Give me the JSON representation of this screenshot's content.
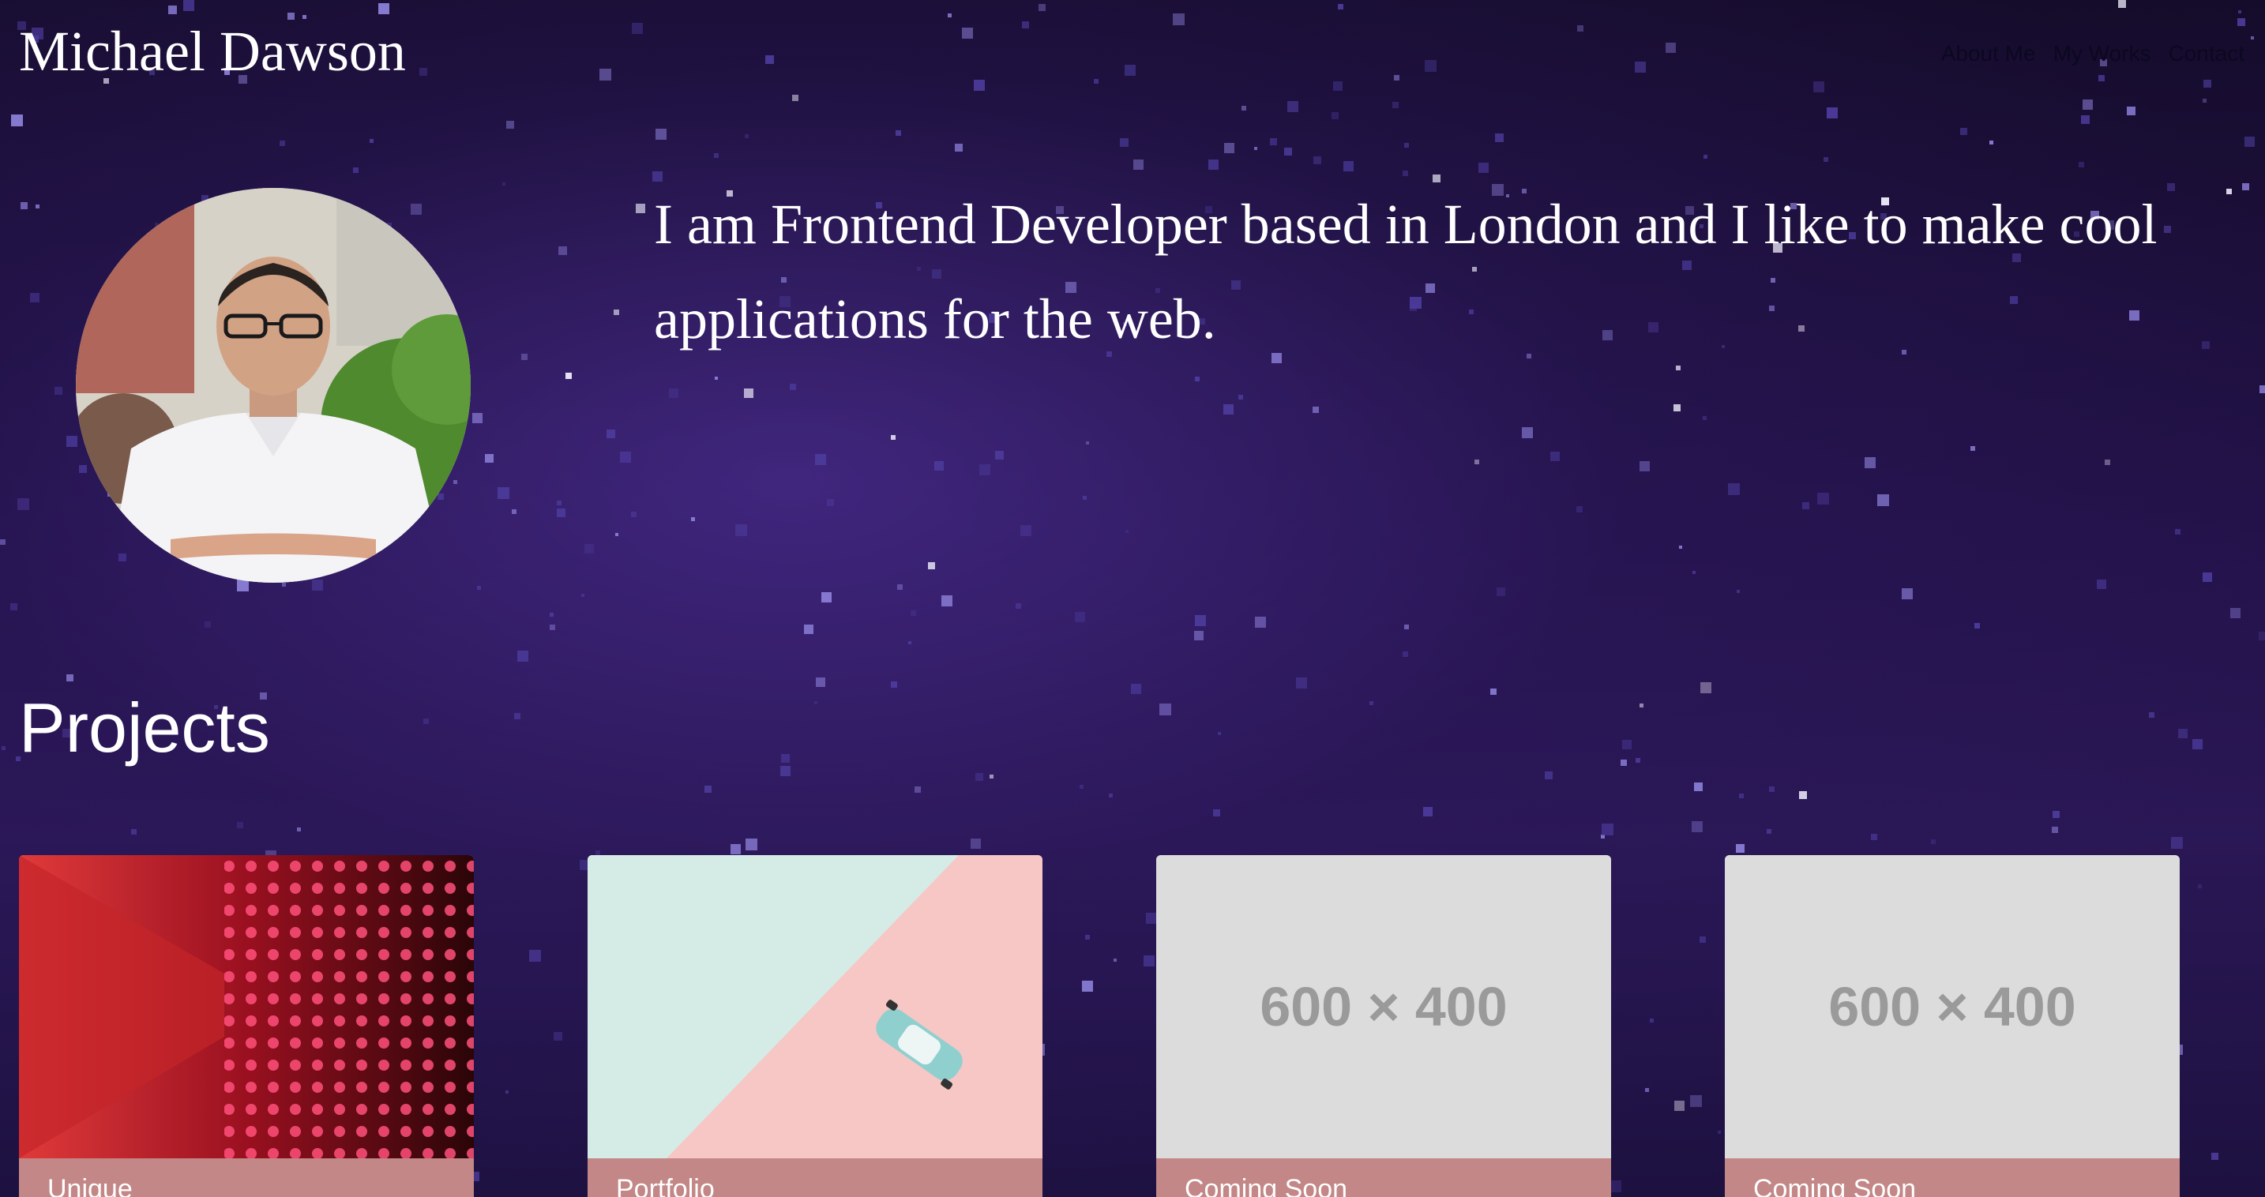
{
  "header": {
    "name": "Michael Dawson",
    "nav": [
      "About Me",
      "My Works",
      "Contact"
    ]
  },
  "intro": {
    "text": "I am Frontend Developer based in London and I like to make cool applications for the web."
  },
  "projects": {
    "title": "Projects",
    "cards": [
      {
        "caption": "Unique",
        "image": "red-led-wall-image"
      },
      {
        "caption": "Portfolio",
        "image": "toy-car-image"
      },
      {
        "caption": "Coming Soon",
        "placeholder": "600 × 400"
      },
      {
        "caption": "Coming Soon",
        "placeholder": "600 × 400"
      }
    ]
  },
  "colors": {
    "background": "#1e1140",
    "caption_bg": "#c28786",
    "placeholder_bg": "#dcdcdc",
    "placeholder_text": "#9a9a9a"
  }
}
